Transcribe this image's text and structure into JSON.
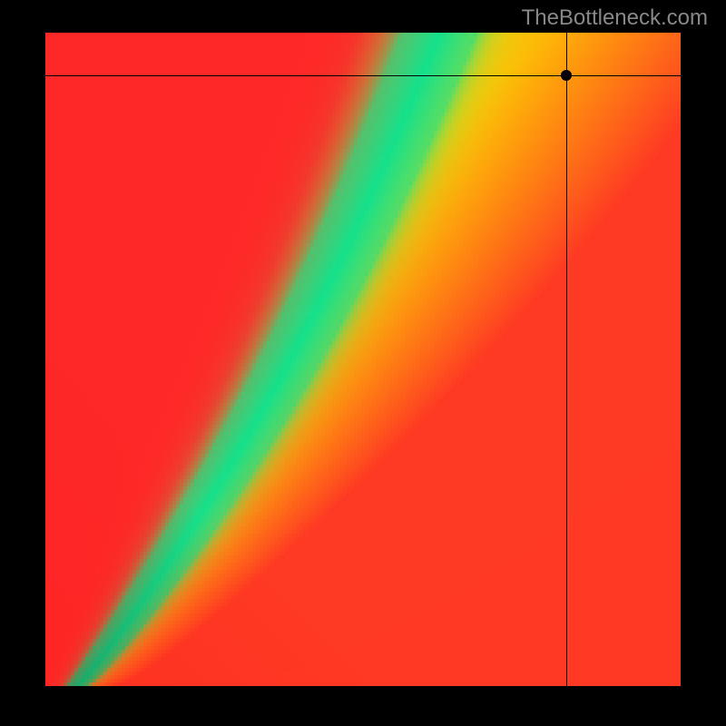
{
  "attribution": "TheBottleneck.com",
  "chart_data": {
    "type": "heatmap",
    "title": "",
    "xlabel": "",
    "ylabel": "",
    "xlim": [
      0,
      1
    ],
    "ylim": [
      0,
      1
    ],
    "color_scale": [
      "#ff2020",
      "#ffcc00",
      "#20e090"
    ],
    "description": "Diagonal green optimal band curving from lower-left to upper-center; red indicates bottleneck regions; yellow/orange transitional.",
    "crosshair": {
      "x": 0.82,
      "y": 0.935
    },
    "marker": {
      "x": 0.82,
      "y": 0.935
    }
  }
}
